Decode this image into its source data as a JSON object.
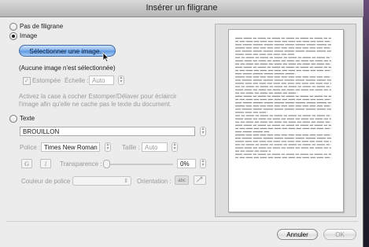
{
  "window": {
    "title": "Insérer un filigrane"
  },
  "options": {
    "no_watermark_label": "Pas de filigrane",
    "image_label": "Image",
    "select_image_button": "Sélectionner une image...",
    "no_image_selected": "(Aucune image n'est sélectionnée)",
    "fade_label": "Estompée",
    "scale_label": "Échelle :",
    "scale_value": "Auto",
    "help_line1": "Activez la case à cocher Estomper/Délaver pour éclaircir",
    "help_line2": "l'image afin qu'elle ne cache pas le texte du document.",
    "text_label": "Texte",
    "text_value": "BROUILLON",
    "font_label": "Police :",
    "font_value": "Times New Roman",
    "size_label": "Taille :",
    "size_value": "Auto",
    "bold_glyph": "G",
    "italic_glyph": "I",
    "transparency_label": "Transparence :",
    "transparency_value": "0%",
    "font_color_label": "Couleur de police :",
    "orientation_label": "Orientation :",
    "orientation_glyph": "abc"
  },
  "selected_option": "image",
  "footer": {
    "cancel_label": "Annuler",
    "ok_label": "OK"
  }
}
